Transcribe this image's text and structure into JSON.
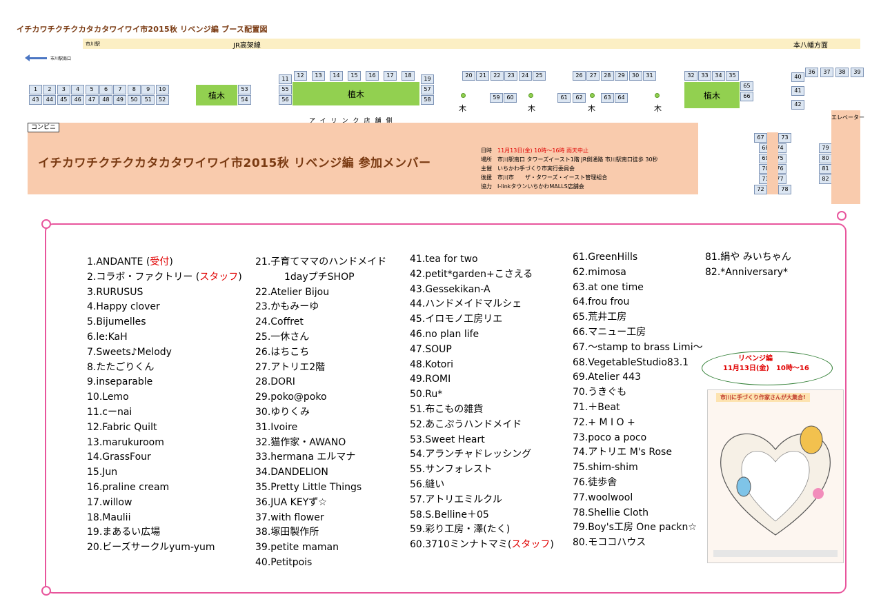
{
  "title": "イチカワチクチクカタカタワイワイ市2015秋 リベンジ編 ブース配置図",
  "rail": {
    "left": "市川駅",
    "center": "JR高架線",
    "right": "本八幡方面"
  },
  "arrow_label": "市川駅南口",
  "tree_label": "植木",
  "small_tree": "木",
  "shop_side": "アイリンク店舗側",
  "convenience": "コンビニ",
  "elevator": "エレベーター",
  "banner": {
    "title": "イチカワチクチクカタカタワイワイ市2015秋 リベンジ編 参加メンバー",
    "date_label": "日時",
    "date_value": "11月13日(金) 10時～16時 雨天中止",
    "place_label": "場所",
    "place_value": "市川駅南口 タワーズイースト1階 JR側通路 市川駅南口徒歩 30秒",
    "host_label": "主催",
    "host_value": "いちかわ手づくり市実行委員会",
    "support_label": "後援",
    "support_value": "市川市　　ザ・タワーズ・イースト管理組合",
    "coop_label": "協力",
    "coop_value": "I-linkタウンいちかわMALLS店舗会"
  },
  "booths": {
    "row_top_a": [
      "1",
      "2",
      "3",
      "4",
      "5",
      "6",
      "7",
      "8",
      "9",
      "10"
    ],
    "row_bot_a": [
      "43",
      "44",
      "45",
      "46",
      "47",
      "48",
      "49",
      "50",
      "51",
      "52"
    ],
    "b53": "53",
    "b54": "54",
    "b11": "11",
    "b55": "55",
    "b56": "56",
    "row_12_18": [
      "12",
      "13",
      "14",
      "15",
      "16",
      "17",
      "18"
    ],
    "b19": "19",
    "b57": "57",
    "b58": "58",
    "row_20_25": [
      "20",
      "21",
      "22",
      "23",
      "24",
      "25"
    ],
    "b59": "59",
    "b60": "60",
    "row_26_31": [
      "26",
      "27",
      "28",
      "29",
      "30",
      "31"
    ],
    "b61": "61",
    "b62": "62",
    "b63": "63",
    "b64": "64",
    "row_32_35": [
      "32",
      "33",
      "34",
      "35"
    ],
    "b65": "65",
    "b66": "66",
    "row_36_39": [
      "36",
      "37",
      "38",
      "39"
    ],
    "b40": "40",
    "b41": "41",
    "b42": "42",
    "b67": "67",
    "b73": "73",
    "left_col": [
      "68",
      "69",
      "70",
      "71"
    ],
    "right_col": [
      "74",
      "75",
      "76",
      "77"
    ],
    "b72": "72",
    "b78": "78",
    "right_stack": [
      "79",
      "80",
      "81",
      "82"
    ]
  },
  "members": {
    "col1": [
      {
        "t": "1.ANDANTE (",
        "r": "受付",
        "e": ")"
      },
      {
        "t": "2.コラボ・ファクトリー (",
        "r": "スタッフ",
        "e": ")"
      },
      {
        "t": "3.RURUSUS"
      },
      {
        "t": "4.Happy clover"
      },
      {
        "t": "5.Bijumelles"
      },
      {
        "t": "6.le:KaH"
      },
      {
        "t": "7.Sweets♪Melody"
      },
      {
        "t": "8.たたごりくん"
      },
      {
        "t": "9.inseparable"
      },
      {
        "t": "10.Lemo"
      },
      {
        "t": "11.cーnai"
      },
      {
        "t": "12.Fabric Quilt"
      },
      {
        "t": "13.marukuroom"
      },
      {
        "t": "14.GrassFour"
      },
      {
        "t": "15.Jun"
      },
      {
        "t": "16.praline  cream"
      },
      {
        "t": "17.willow"
      },
      {
        "t": "18.Maulii"
      },
      {
        "t": "19.まあるい広場"
      },
      {
        "t": "20.ビーズサークルyum-yum"
      }
    ],
    "col2": [
      {
        "t": "21.子育てママのハンドメイド"
      },
      {
        "t": "　　　1dayプチSHOP"
      },
      {
        "t": "22.Atelier Bijou"
      },
      {
        "t": "23.かもみーゆ"
      },
      {
        "t": "24.Coffret"
      },
      {
        "t": "25.一休さん"
      },
      {
        "t": "26.はちこち"
      },
      {
        "t": "27.アトリエ2階"
      },
      {
        "t": "28.DORI"
      },
      {
        "t": "29.poko@poko"
      },
      {
        "t": "30.ゆりくみ"
      },
      {
        "t": "31.Ivoire"
      },
      {
        "t": "32.猫作家・AWANO"
      },
      {
        "t": "33.hermana エルマナ"
      },
      {
        "t": "34.DANDELION"
      },
      {
        "t": "35.Pretty Little Things"
      },
      {
        "t": "36.JUA KEYず☆"
      },
      {
        "t": "37.with flower"
      },
      {
        "t": "38.塚田製作所"
      },
      {
        "t": "39.petite maman"
      },
      {
        "t": "40.Petitpois"
      }
    ],
    "col3": [
      {
        "t": "41.tea for two"
      },
      {
        "t": "42.petit*garden+こさえる"
      },
      {
        "t": "43.Gessekikan-A"
      },
      {
        "t": "44.ハンドメイドマルシェ"
      },
      {
        "t": "45.イロモノ工房リエ"
      },
      {
        "t": "46.no plan life"
      },
      {
        "t": "47.SOUP"
      },
      {
        "t": "48.Kotori"
      },
      {
        "t": "49.ROMI"
      },
      {
        "t": "50.Ru*"
      },
      {
        "t": "51.布こもの雑貨"
      },
      {
        "t": "52.あこぷうハンドメイド"
      },
      {
        "t": "53.Sweet Heart"
      },
      {
        "t": "54.アランチャドレッシング"
      },
      {
        "t": "55.サンフォレスト"
      },
      {
        "t": "56.縫い"
      },
      {
        "t": "57.アトリエミルクル"
      },
      {
        "t": "58.S.Belline＋05"
      },
      {
        "t": "59.彩り工房・澤(たく)"
      },
      {
        "t": "60.3710ミンナトマミ(",
        "r": "スタッフ",
        "e": ")"
      }
    ],
    "col4": [
      {
        "t": "61.GreenHills"
      },
      {
        "t": "62.mimosa"
      },
      {
        "t": "63.at one time"
      },
      {
        "t": "64.frou frou"
      },
      {
        "t": "65.荒井工房"
      },
      {
        "t": "66.マニュー工房"
      },
      {
        "t": "67.～stamp to brass Limi～"
      },
      {
        "t": "68.VegetableStudio83.1"
      },
      {
        "t": "69.Atelier 443"
      },
      {
        "t": "70.うきぐも"
      },
      {
        "t": "71.＋Beat"
      },
      {
        "t": "72.+ M I O +"
      },
      {
        "t": "73.poco a poco"
      },
      {
        "t": "74.アトリエ M's Rose"
      },
      {
        "t": "75.shim-shim"
      },
      {
        "t": "76.徒歩舎"
      },
      {
        "t": "77.woolwool"
      },
      {
        "t": "78.Shellie Cloth"
      },
      {
        "t": "79.Boy's工房 One packn☆"
      },
      {
        "t": "80.モココハウス"
      }
    ],
    "col5": [
      {
        "t": "81.絹や みいちゃん"
      },
      {
        "t": "82.*Anniversary*"
      }
    ]
  },
  "bubble": {
    "line1": "リベンジ編",
    "line2": "11月13日(金)　10時～16"
  },
  "flyer": {
    "banner": "市川に手づくり作家さんが大集合!"
  }
}
